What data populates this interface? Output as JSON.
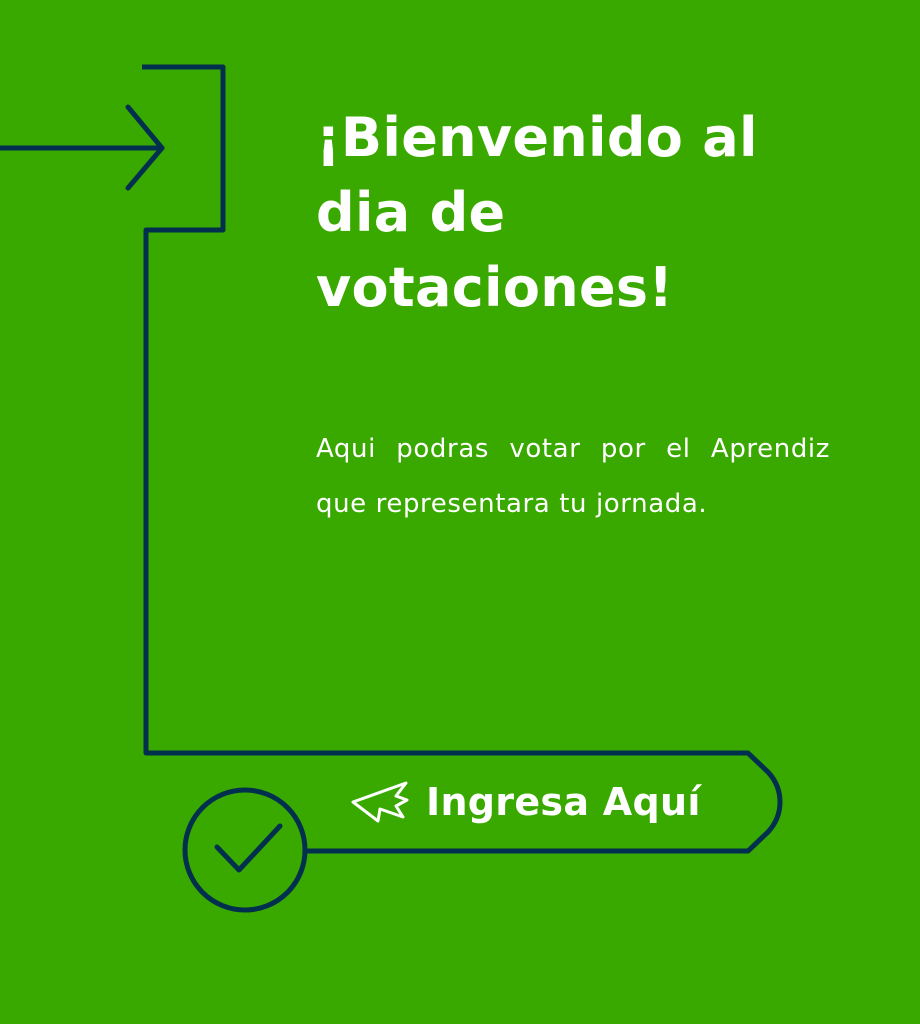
{
  "welcome": {
    "title_lines": [
      "¡Bienvenido al",
      "dia de",
      "votaciones!"
    ],
    "description": "Aqui podras votar por el Aprendiz que representara tu jornada."
  },
  "cta": {
    "label": "Ingresa Aquí",
    "icon": "cursor-arrow-icon"
  },
  "decor": {
    "arrow_icon": "arrow-right-icon",
    "check_icon": "checkmark-circle-icon"
  },
  "colors": {
    "background": "#39a900",
    "line": "#00304d",
    "text": "#ffffff"
  }
}
